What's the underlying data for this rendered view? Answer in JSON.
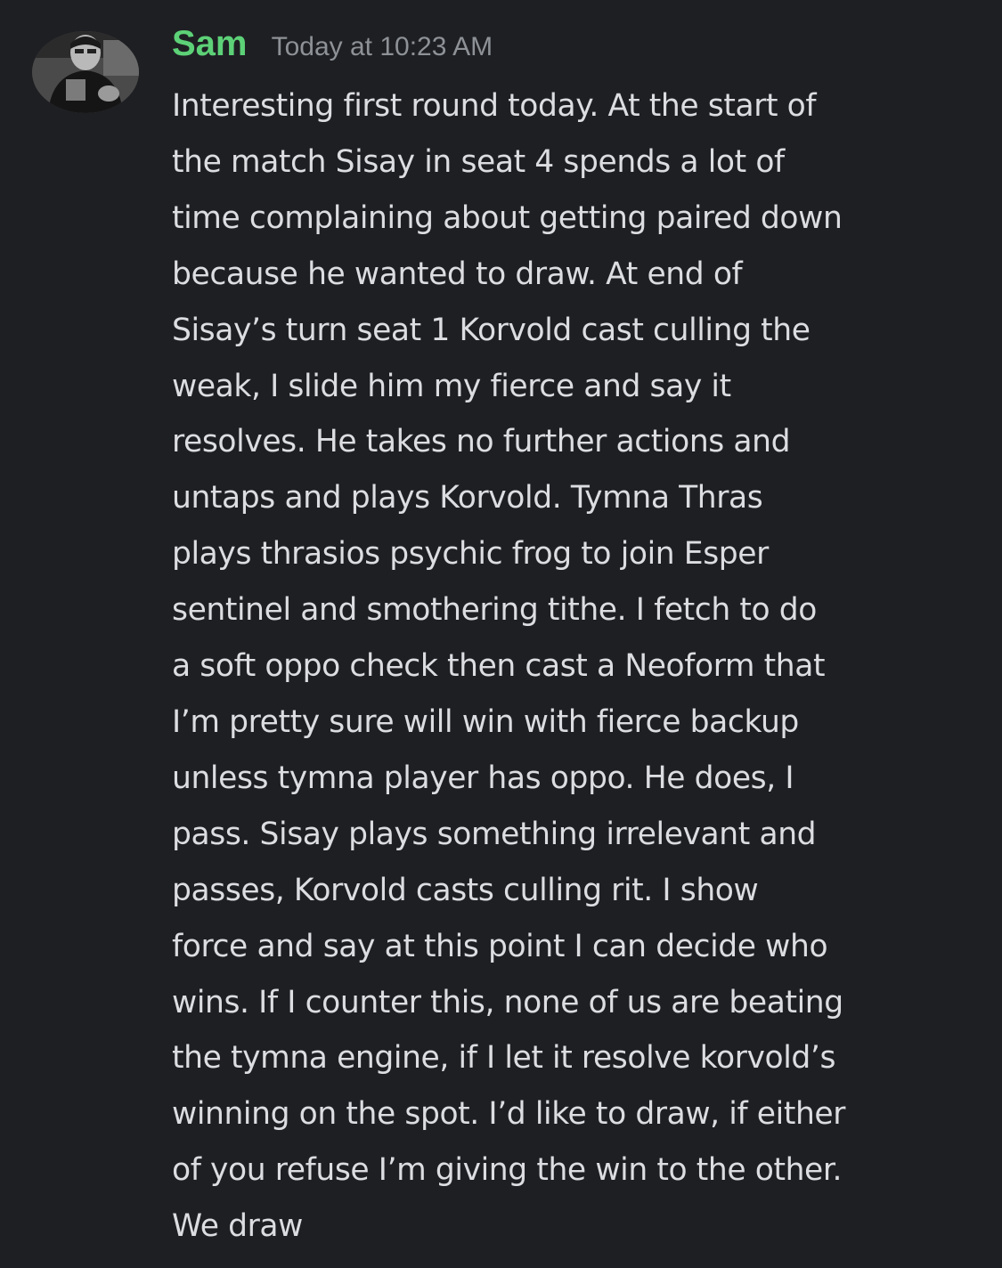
{
  "message": {
    "author": {
      "name": "Sam",
      "name_color": "#5dd177",
      "avatar": "user-avatar-photo"
    },
    "timestamp": "Today at 10:23 AM",
    "lines": [
      "Interesting first round today. At the start of",
      "the match Sisay in seat 4 spends a lot of",
      "time complaining about getting paired down",
      "because he wanted to draw. At end of",
      "Sisay’s turn seat 1 Korvold cast culling the",
      "weak, I slide him my fierce and say it",
      "resolves. He takes no further actions and",
      "untaps and plays Korvold. Tymna Thras",
      "plays thrasios psychic frog to join Esper",
      "sentinel and smothering tithe. I fetch to do",
      "a soft oppo check then cast a Neoform that",
      "I’m pretty sure will win with fierce backup",
      "unless tymna player has oppo. He does, I",
      "pass. Sisay plays something irrelevant and",
      "passes, Korvold casts culling rit. I show",
      "force and say at this point I can decide who",
      "wins. If I counter this, none of us are beating",
      "the tymna engine, if I let it resolve korvold’s",
      "winning on the spot. I’d like to draw, if either",
      "of you refuse I’m giving the win to the other.",
      "We draw"
    ]
  },
  "theme": {
    "background": "#1e1f23",
    "text": "#dcdde0",
    "muted": "#8e9297"
  }
}
